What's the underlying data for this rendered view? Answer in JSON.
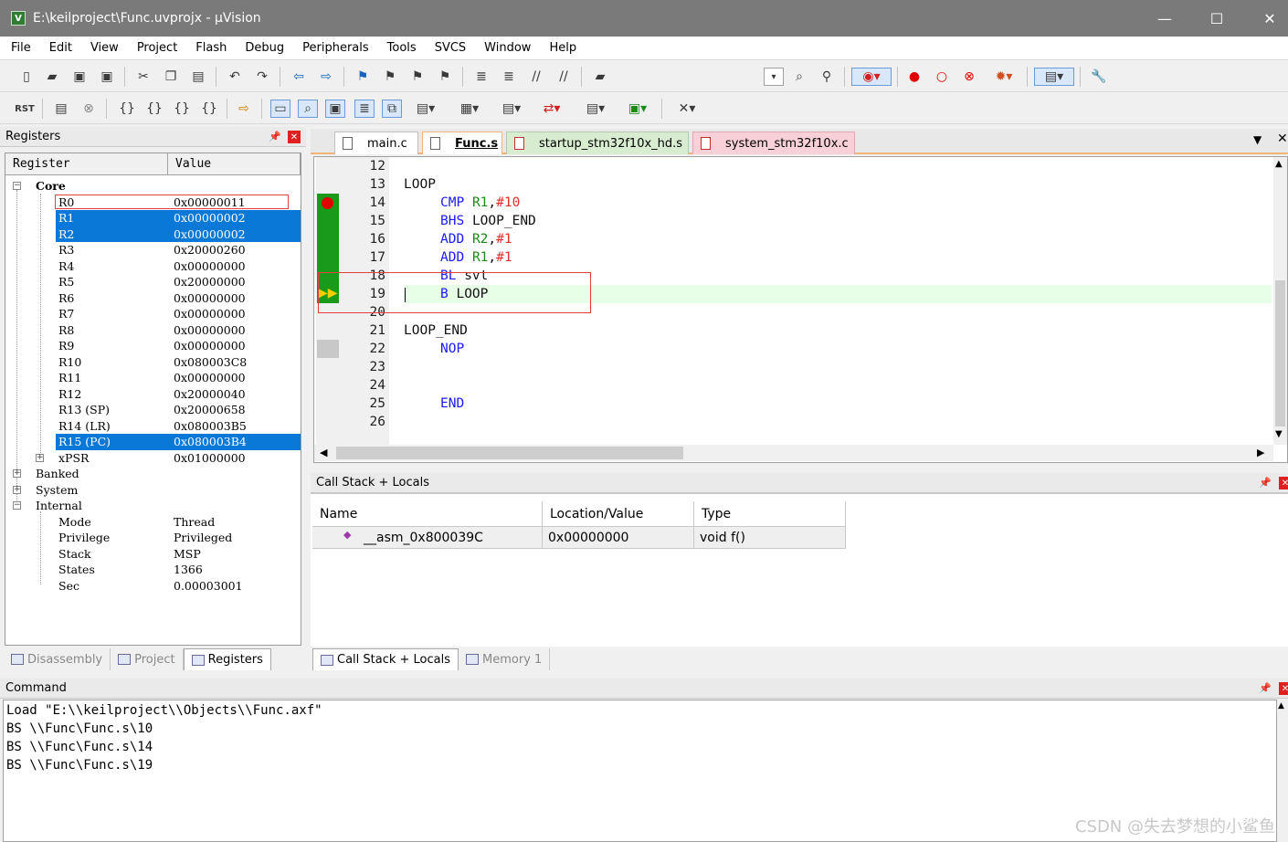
{
  "window": {
    "title": "E:\\keilproject\\Func.uvprojx - µVision",
    "minimize": "—",
    "maximize": "☐",
    "close": "✕"
  },
  "menu": [
    "File",
    "Edit",
    "View",
    "Project",
    "Flash",
    "Debug",
    "Peripherals",
    "Tools",
    "SVCS",
    "Window",
    "Help"
  ],
  "registers": {
    "panel_title": "Registers",
    "col_register": "Register",
    "col_value": "Value",
    "core_label": "Core",
    "rows": [
      {
        "name": "R0",
        "value": "0x00000011"
      },
      {
        "name": "R1",
        "value": "0x00000002"
      },
      {
        "name": "R2",
        "value": "0x00000002"
      },
      {
        "name": "R3",
        "value": "0x20000260"
      },
      {
        "name": "R4",
        "value": "0x00000000"
      },
      {
        "name": "R5",
        "value": "0x20000000"
      },
      {
        "name": "R6",
        "value": "0x00000000"
      },
      {
        "name": "R7",
        "value": "0x00000000"
      },
      {
        "name": "R8",
        "value": "0x00000000"
      },
      {
        "name": "R9",
        "value": "0x00000000"
      },
      {
        "name": "R10",
        "value": "0x080003C8"
      },
      {
        "name": "R11",
        "value": "0x00000000"
      },
      {
        "name": "R12",
        "value": "0x20000040"
      },
      {
        "name": "R13 (SP)",
        "value": "0x20000658"
      },
      {
        "name": "R14 (LR)",
        "value": "0x080003B5"
      },
      {
        "name": "R15 (PC)",
        "value": "0x080003B4"
      },
      {
        "name": "xPSR",
        "value": "0x01000000"
      }
    ],
    "groups": [
      "Banked",
      "System",
      "Internal"
    ],
    "internal": [
      {
        "name": "Mode",
        "value": "Thread"
      },
      {
        "name": "Privilege",
        "value": "Privileged"
      },
      {
        "name": "Stack",
        "value": "MSP"
      },
      {
        "name": "States",
        "value": "1366"
      },
      {
        "name": "Sec",
        "value": "0.00003001"
      }
    ]
  },
  "left_tabs": [
    "Disassembly",
    "Project",
    "Registers"
  ],
  "editor": {
    "tabs": [
      "main.c",
      "Func.s",
      "startup_stm32f10x_hd.s",
      "system_stm32f10x.c"
    ],
    "line_numbers": [
      "12",
      "13",
      "14",
      "15",
      "16",
      "17",
      "18",
      "19",
      "20",
      "21",
      "22",
      "23",
      "24",
      "25",
      "26"
    ],
    "lines": {
      "l13": "LOOP",
      "l14_op": "CMP",
      "l14_reg": "R1",
      "l14_imm": "#10",
      "l15_op": "BHS",
      "l15_arg": "LOOP_END",
      "l16_op": "ADD",
      "l16_reg": "R2",
      "l16_imm": "#1",
      "l17_op": "ADD",
      "l17_reg": "R1",
      "l17_imm": "#1",
      "l18_op": "BL",
      "l18_arg": "svt",
      "l19_op": "B",
      "l19_arg": "LOOP",
      "l21": "LOOP_END",
      "l22": "NOP",
      "l25": "END"
    }
  },
  "callstack": {
    "panel_title": "Call Stack + Locals",
    "col_name": "Name",
    "col_location": "Location/Value",
    "col_type": "Type",
    "row_name": "__asm_0x800039C",
    "row_location": "0x00000000",
    "row_type": "void f()"
  },
  "middle_tabs": [
    "Call Stack + Locals",
    "Memory 1"
  ],
  "command": {
    "panel_title": "Command",
    "lines": [
      "Load \"E:\\\\keilproject\\\\Objects\\\\Func.axf\"",
      "BS \\\\Func\\Func.s\\10",
      "BS \\\\Func\\Func.s\\14",
      "BS \\\\Func\\Func.s\\19"
    ]
  },
  "watermark": "CSDN @失去梦想的小鲨鱼",
  "colors": {
    "selection": "#0a78d7",
    "breakpoint": "#e00000",
    "gutter_green": "#1a9a1a",
    "current_line": "#e6ffe6",
    "annotation_box": "#e04040"
  }
}
